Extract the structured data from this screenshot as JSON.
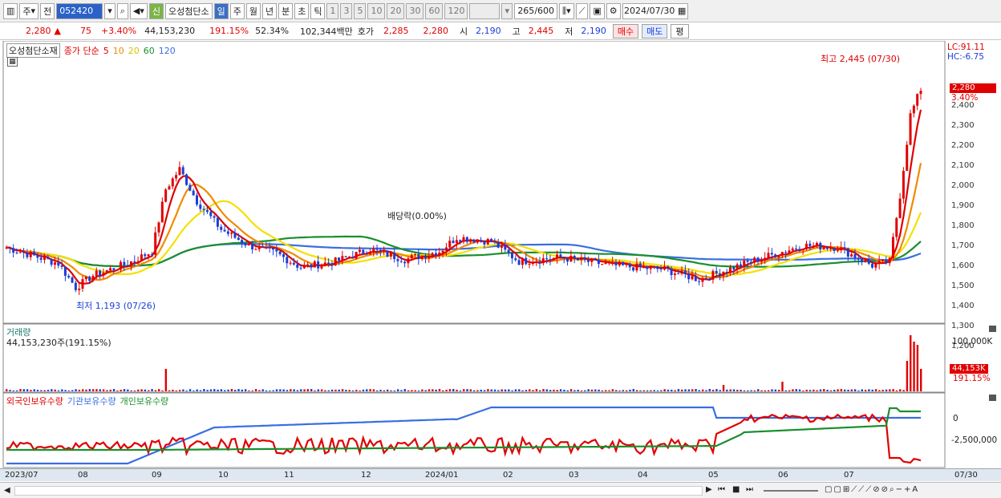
{
  "toolbar": {
    "market": "주",
    "price_kind": "전",
    "code": "052420",
    "name_tag": "신",
    "stock_name": "오성첨단소",
    "periods": [
      "일",
      "주",
      "월",
      "년",
      "분",
      "초",
      "틱"
    ],
    "intervals": [
      "1",
      "3",
      "5",
      "10",
      "20",
      "30",
      "60",
      "120"
    ],
    "count": "265",
    "count_total": "/600",
    "date": "2024/07/30"
  },
  "quote": {
    "price": "2,280",
    "change": "75",
    "change_pct": "+3.40%",
    "volume": "44,153,230",
    "vol_pct": "191.15%",
    "ratio": "52.34%",
    "amount": "102,344백만",
    "bid_label": "호가",
    "bid1": "2,285",
    "bid2": "2,280",
    "open_label": "시",
    "open": "2,190",
    "high_label": "고",
    "high": "2,445",
    "low_label": "저",
    "low": "2,190",
    "buy_label": "매수",
    "sell_label": "매도",
    "eval_label": "평"
  },
  "price_panel": {
    "stock": "오성첨단소재",
    "ma_label": "종가 단순",
    "ma_periods": [
      "5",
      "10",
      "20",
      "60",
      "120"
    ],
    "lc": "LC:91.11",
    "hc": "HC:-6.75",
    "badge_price": "2,280",
    "badge_pct": "3.40%",
    "high_note": "최고 2,445 (07/30)",
    "low_note": "최저 1,193 (07/26)",
    "dividend_note": "배당락(0.00%)",
    "y_ticks": [
      "2,400",
      "2,300",
      "2,200",
      "2,100",
      "2,000",
      "1,900",
      "1,800",
      "1,700",
      "1,600",
      "1,500",
      "1,400",
      "1,300",
      "1,200"
    ]
  },
  "volume_panel": {
    "title": "거래량",
    "value": "44,153,230주(191.15%)",
    "tick": "100,000K",
    "badge": "44,153K",
    "badge_pct": "191.15%"
  },
  "holding_panel": {
    "series": [
      "외국인보유수량",
      "기관보유수량",
      "개인보유수량"
    ],
    "ticks": [
      "0",
      "-2,500,000"
    ]
  },
  "x_axis": {
    "labels": [
      "2023/07",
      "08",
      "09",
      "10",
      "11",
      "12",
      "2024/01",
      "02",
      "03",
      "04",
      "05",
      "06",
      "07",
      "07/30"
    ]
  },
  "colors": {
    "up": "#e00000",
    "down": "#1a3fd6",
    "ma5": "#e00000",
    "ma10": "#f08a00",
    "ma20": "#f5e000",
    "ma60": "#1a8f2e",
    "ma120": "#3a6ee0"
  }
}
